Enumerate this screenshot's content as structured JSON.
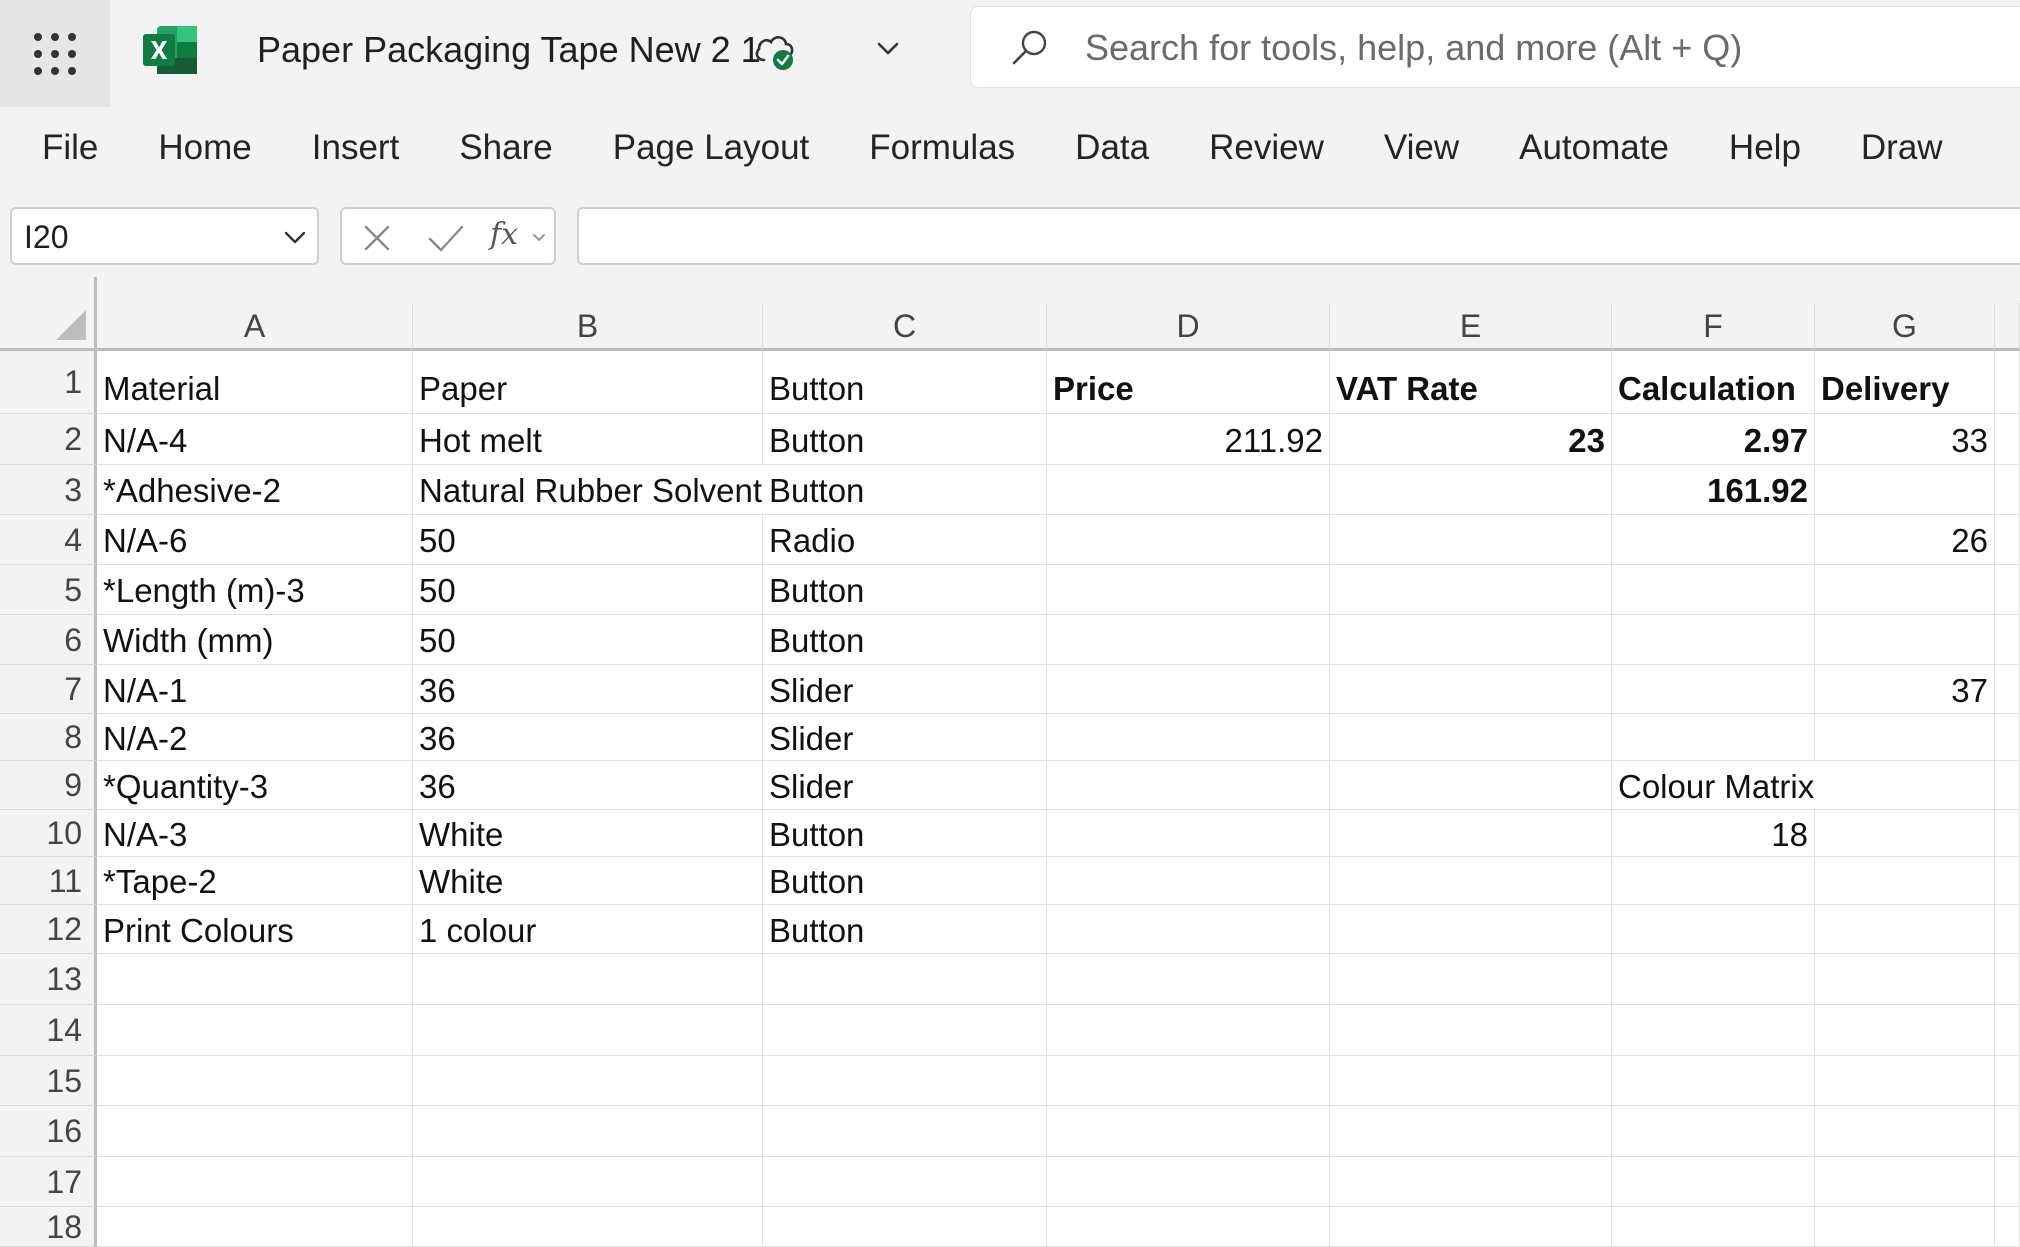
{
  "app": {
    "document_title": "Paper Packaging Tape New 2 1",
    "brand_color": "#107c41",
    "icons": [
      "app-launcher-icon",
      "excel-logo-icon",
      "cloud-saved-icon",
      "chevron-down-icon",
      "search-icon"
    ]
  },
  "search": {
    "placeholder": "Search for tools, help, and more (Alt + Q)"
  },
  "menu": [
    "File",
    "Home",
    "Insert",
    "Share",
    "Page Layout",
    "Formulas",
    "Data",
    "Review",
    "View",
    "Automate",
    "Help",
    "Draw"
  ],
  "formula_bar": {
    "name_box": "I20",
    "formula": ""
  },
  "sheet": {
    "columns": [
      "A",
      "B",
      "C",
      "D",
      "E",
      "F",
      "G"
    ],
    "rows": [
      "1",
      "2",
      "3",
      "4",
      "5",
      "6",
      "7",
      "8",
      "9",
      "10",
      "11",
      "12",
      "13",
      "14",
      "15",
      "16",
      "17",
      "18"
    ],
    "cells": {
      "A1": "Material",
      "B1": "Paper",
      "C1": "Button",
      "D1": "Price",
      "E1": "VAT Rate",
      "F1": "Calculation",
      "G1": "Delivery",
      "A2": "N/A-4",
      "B2": "Hot melt",
      "C2": "Button",
      "D2": "211.92",
      "E2": "23",
      "F2": "2.97",
      "G2": "33",
      "A3": "*Adhesive-2",
      "B3": "Natural Rubber Solvent",
      "C3": "Button",
      "F3": "161.92",
      "A4": "N/A-6",
      "B4": "50",
      "C4": "Radio",
      "G4": "26",
      "A5": "*Length (m)-3",
      "B5": "50",
      "C5": "Button",
      "A6": "Width (mm)",
      "B6": "50",
      "C6": "Button",
      "A7": "N/A-1",
      "B7": "36",
      "C7": "Slider",
      "G7": "37",
      "A8": "N/A-2",
      "B8": "36",
      "C8": "Slider",
      "A9": "*Quantity-3",
      "B9": "36",
      "C9": "Slider",
      "F9": "Colour Matrix",
      "A10": "N/A-3",
      "B10": "White",
      "C10": "Button",
      "F10": "18",
      "A11": "*Tape-2",
      "B11": "White",
      "C11": "Button",
      "A12": "Print Colours",
      "B12": "1 colour",
      "C12": "Button"
    }
  }
}
